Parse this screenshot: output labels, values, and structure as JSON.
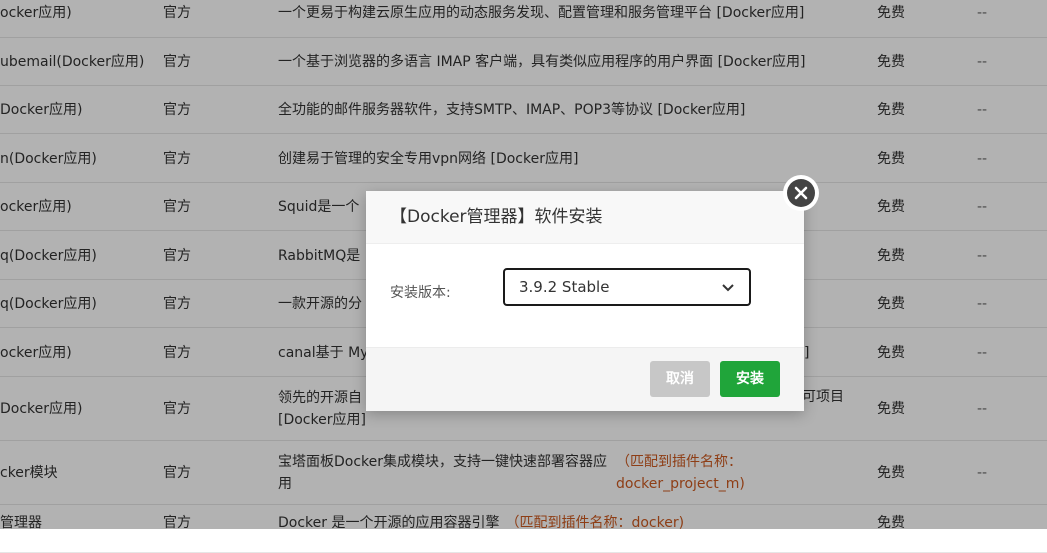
{
  "table": {
    "rows": [
      {
        "name": "ocker应用)",
        "source": "官方",
        "desc": "一个更易于构建云原生应用的动态服务发现、配置管理和服务管理平台 [Docker应用]",
        "price": "免费",
        "op": "--"
      },
      {
        "name": "ubemail(Docker应用)",
        "source": "官方",
        "desc": "一个基于浏览器的多语言 IMAP 客户端，具有类似应用程序的用户界面 [Docker应用]",
        "price": "免费",
        "op": "--"
      },
      {
        "name": "Docker应用)",
        "source": "官方",
        "desc": "全功能的邮件服务器软件，支持SMTP、IMAP、POP3等协议 [Docker应用]",
        "price": "免费",
        "op": "--"
      },
      {
        "name": "n(Docker应用)",
        "source": "官方",
        "desc": "创建易于管理的安全专用vpn网络 [Docker应用]",
        "price": "免费",
        "op": "--"
      },
      {
        "name": "ocker应用)",
        "source": "官方",
        "desc": "Squid是一个",
        "price": "免费",
        "op": "--"
      },
      {
        "name": "q(Docker应用)",
        "source": "官方",
        "desc": "RabbitMQ是",
        "price": "免费",
        "op": "--"
      },
      {
        "name": "q(Docker应用)",
        "source": "官方",
        "desc": "一款开源的分",
        "price": "免费",
        "op": "--"
      },
      {
        "name": "ocker应用)",
        "source": "官方",
        "desc": "canal基于 My",
        "desc_tail": "]",
        "price": "免费",
        "op": "--"
      },
      {
        "name": "Docker应用)",
        "source": "官方",
        "desc": "领先的开源自",
        "desc2": "[Docker应用]",
        "desc_tail": "可项目",
        "price": "免费",
        "op": "--"
      },
      {
        "name": "cker模块",
        "source": "官方",
        "desc": "宝塔面板Docker集成模块，支持一键快速部署容器应用",
        "tag": "（匹配到插件名称：docker_project_m)",
        "price": "免费",
        "op": "--"
      },
      {
        "name": "管理器",
        "source": "官方",
        "desc": "Docker 是一个开源的应用容器引擎",
        "tag": "（匹配到插件名称：docker)",
        "price": "免费",
        "op": "--"
      }
    ]
  },
  "dialog": {
    "title": "【Docker管理器】软件安装",
    "version_label": "安装版本:",
    "version_value": "3.9.2 Stable",
    "cancel_label": "取消",
    "install_label": "安装"
  },
  "icons": {
    "close": "close-icon",
    "select_arrow": "chevron-down-icon"
  },
  "colors": {
    "install": "#20a53a",
    "cancel": "#c7c7c7",
    "match_tag": "#cc5a20"
  }
}
